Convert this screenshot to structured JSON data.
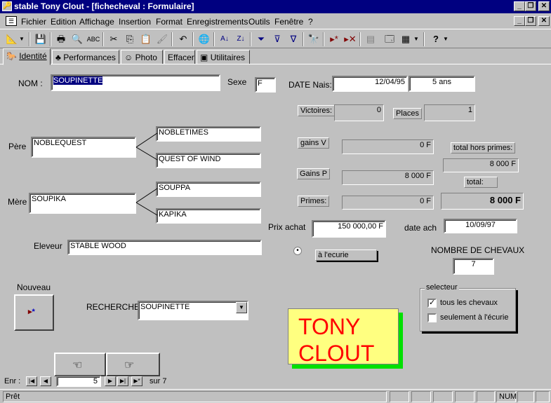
{
  "window": {
    "title": "stable Tony Clout - [fichecheval : Formulaire]"
  },
  "menu": [
    "Fichier",
    "Edition",
    "Affichage",
    "Insertion",
    "Format",
    "Enregistrements",
    "Outils",
    "Fenêtre",
    "?"
  ],
  "tabs": [
    "Identité",
    "Performances",
    "Photo",
    "Effacer",
    "Utilitaires"
  ],
  "form": {
    "nom_label": "NOM :",
    "nom_value": "SOUPINETTE",
    "sexe_label": "Sexe",
    "sexe_value": "F",
    "date_label": "DATE Nais:",
    "date_value": "12/04/95",
    "age_value": "5 ans",
    "victoires_label": "Victoires:",
    "victoires_value": "0",
    "places_label": "Places",
    "places_value": "1",
    "pere_label": "Père",
    "pere_value": "NOBLEQUEST",
    "pere_pere": "NOBLETIMES",
    "pere_mere": "QUEST OF WIND",
    "mere_label": "Mère",
    "mere_value": "SOUPIKA",
    "mere_pere": "SOUPPA",
    "mere_mere": "KAPIKA",
    "eleveur_label": "Eleveur",
    "eleveur_value": "STABLE WOOD",
    "gainsv_label": "gains V",
    "gainsv_value": "0 F",
    "gainsp_label": "Gains P",
    "gainsp_value": "8 000 F",
    "primes_label": "Primes:",
    "primes_value": "0 F",
    "total_hors_label": "total hors primes:",
    "total_hors_value": "8 000 F",
    "total_label": "total:",
    "total_value": "8 000 F",
    "prix_label": "Prix achat",
    "prix_value": "150 000,00 F",
    "date_ach_label": "date ach",
    "date_ach_value": "10/09/97",
    "ecurie_label": "à l'ecurie",
    "nombre_label": "NOMBRE DE CHEVAUX",
    "nombre_value": "7",
    "nouveau_label": "Nouveau",
    "recherche_label": "RECHERCHE",
    "recherche_value": "SOUPINETTE",
    "selecteur_label": "selecteur",
    "opt_tous": "tous les chevaux",
    "opt_seulement": "seulement à l'écurie",
    "logo_text": "TONY CLOUT"
  },
  "nav": {
    "label": "Enr :",
    "current": "5",
    "of": "sur 7"
  },
  "status": {
    "text": "Prêt",
    "num": "NUM"
  }
}
